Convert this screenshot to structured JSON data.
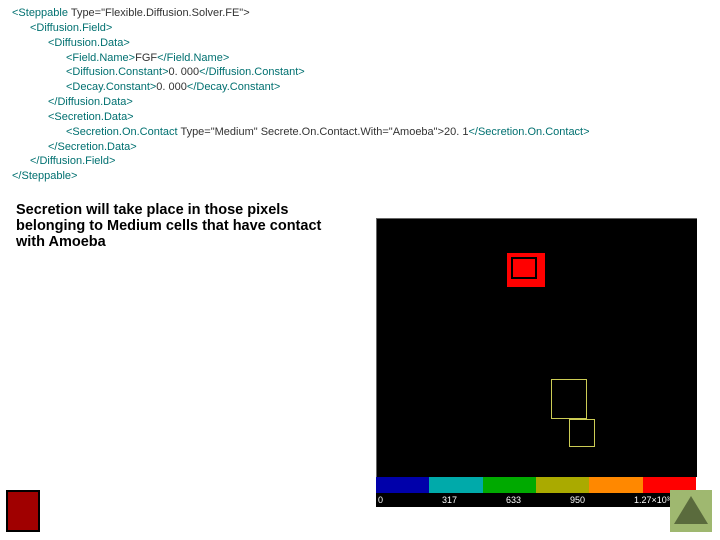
{
  "code": {
    "l1a": "<Steppable",
    "l1b": " Type=\"Flexible.Diffusion.Solver.FE\">",
    "l2": "<Diffusion.Field>",
    "l3": "<Diffusion.Data>",
    "l4a": "<Field.Name>",
    "l4b": "FGF",
    "l4c": "</Field.Name>",
    "l5a": "<Diffusion.Constant>",
    "l5b": "0. 000",
    "l5c": "</Diffusion.Constant>",
    "l6a": "<Decay.Constant>",
    "l6b": "0. 000",
    "l6c": "</Decay.Constant>",
    "l7": "</Diffusion.Data>",
    "l8": "<Secretion.Data>",
    "l9a": "<Secretion.On.Contact",
    "l9b": " Type=\"Medium\" Secrete.On.Contact.With=\"Amoeba\">",
    "l9c": "20. 1",
    "l9d": "</Secretion.On.Contact>",
    "l10": "</Secretion.Data>",
    "l11": "</Diffusion.Field>",
    "l12": "</Steppable>"
  },
  "description": "Secretion will take place in those pixels belonging to Medium cells that have contact with Amoeba",
  "colorbar": {
    "colors": [
      "#0000aa",
      "#00aaaa",
      "#00aa00",
      "#aaaa00",
      "#ff8800",
      "#ff0000"
    ],
    "ticks": [
      "0",
      "317",
      "633",
      "950",
      "1.27×10³"
    ]
  }
}
